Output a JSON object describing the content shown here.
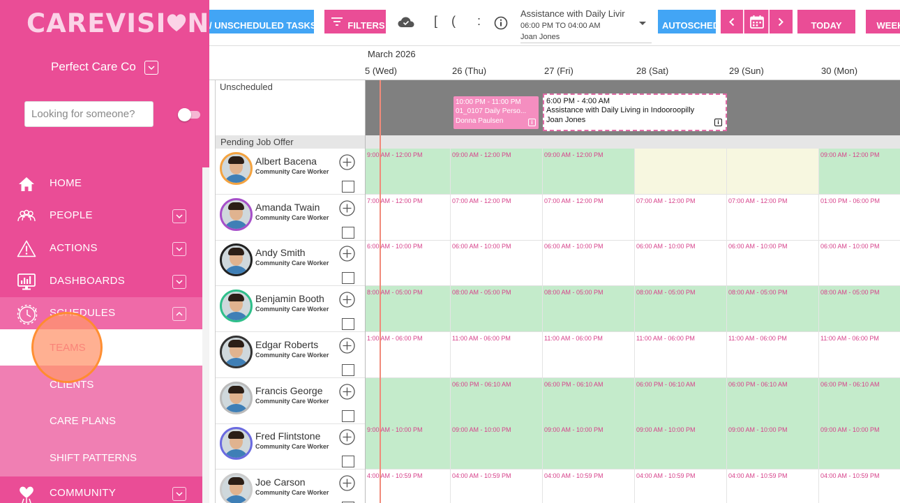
{
  "app": {
    "logo_prefix": "CAREVISI",
    "logo_suffix": "N",
    "organisation": "Perfect Care Co"
  },
  "search": {
    "placeholder": "Looking for someone?"
  },
  "nav": {
    "home": "HOME",
    "people": "PEOPLE",
    "actions": "ACTIONS",
    "dashboards": "DASHBOARDS",
    "schedules": "SCHEDULES",
    "teams": "TEAMS",
    "clients": "CLIENTS",
    "care_plans": "CARE PLANS",
    "shift_patterns": "SHIFT PATTERNS",
    "community": "COMMUNITY"
  },
  "toolbar": {
    "unscheduled_tasks": "/ UNSCHEDULED TASKS",
    "filters": "FILTERS",
    "glyph_a": "[",
    "glyph_b": "(",
    "glyph_c": ":",
    "autoschedule": "AUTOSCHED",
    "today": "TODAY",
    "week": "WEEK"
  },
  "selected_task": {
    "title": "Assistance with Daily Livir",
    "time": "06:00 PM TO 04:00 AM",
    "person": "Joan Jones"
  },
  "calendar": {
    "month": "March 2026",
    "days": [
      "5 (Wed)",
      "26 (Thu)",
      "27 (Fri)",
      "28 (Sat)",
      "29 (Sun)",
      "30 (Mon)"
    ],
    "unscheduled_label": "Unscheduled",
    "pending_label": "Pending Job Offer",
    "unscheduled_tasks": [
      {
        "time": "10:00 PM - 11:00 PM",
        "title": "01_0107 Daily Perso...",
        "person": "Donna Paulsen"
      },
      {
        "time": "6:00 PM - 4:00 AM",
        "title": "Assistance with Daily Living in Indooroopilly",
        "person": "Joan Jones"
      }
    ],
    "info_glyph": "i"
  },
  "colors": {
    "brand_pink": "#ea4d96",
    "action_blue": "#42a5f5",
    "available_green": "#c4ebcb",
    "shift_text": "#d6418a"
  },
  "staff": [
    {
      "name": "Albert Bacena",
      "role": "Community Care Worker",
      "ring": "#f4a340",
      "shifts": [
        "9:00 AM - 12:00 PM",
        "09:00 AM - 12:00 PM",
        "09:00 AM - 12:00 PM",
        "",
        "",
        "09:00 AM - 12:00 PM"
      ],
      "avail": [
        1,
        1,
        1,
        2,
        2,
        1
      ]
    },
    {
      "name": "Amanda Twain",
      "role": "Community Care Worker",
      "ring": "#a64fc9",
      "shifts": [
        "7:00 AM - 12:00 PM",
        "07:00 AM - 12:00 PM",
        "07:00 AM - 12:00 PM",
        "07:00 AM - 12:00 PM",
        "07:00 AM - 12:00 PM",
        "01:00 PM - 06:00 PM"
      ],
      "avail": [
        0,
        0,
        0,
        0,
        0,
        0
      ]
    },
    {
      "name": "Andy Smith",
      "role": "Community Care Worker",
      "ring": "#222222",
      "shifts": [
        "6:00 AM - 10:00 PM",
        "06:00 AM - 10:00 PM",
        "06:00 AM - 10:00 PM",
        "06:00 AM - 10:00 PM",
        "06:00 AM - 10:00 PM",
        "06:00 AM - 10:00 PM"
      ],
      "avail": [
        0,
        0,
        0,
        0,
        0,
        0
      ]
    },
    {
      "name": "Benjamin Booth",
      "role": "Community Care Worker",
      "ring": "#2fbf8a",
      "shifts": [
        "8:00 AM - 05:00 PM",
        "08:00 AM - 05:00 PM",
        "08:00 AM - 05:00 PM",
        "08:00 AM - 05:00 PM",
        "08:00 AM - 05:00 PM",
        "08:00 AM - 05:00 PM"
      ],
      "avail": [
        1,
        1,
        1,
        1,
        1,
        1
      ]
    },
    {
      "name": "Edgar Roberts",
      "role": "Community Care Worker",
      "ring": "#333333",
      "shifts": [
        "1:00 AM - 06:00 PM",
        "11:00 AM - 06:00 PM",
        "11:00 AM - 06:00 PM",
        "11:00 AM - 06:00 PM",
        "11:00 AM - 06:00 PM",
        "11:00 AM - 06:00 PM"
      ],
      "avail": [
        0,
        0,
        0,
        0,
        0,
        0
      ]
    },
    {
      "name": "Francis George",
      "role": "Community Care Worker",
      "ring": "#bbbbbb",
      "shifts": [
        "",
        "06:00 PM - 06:10 AM",
        "06:00 PM - 06:10 AM",
        "06:00 PM - 06:10 AM",
        "06:00 PM - 06:10 AM",
        "06:00 PM - 06:10 AM"
      ],
      "avail": [
        1,
        1,
        1,
        1,
        1,
        1
      ]
    },
    {
      "name": "Fred Flintstone",
      "role": "Community Care Worker",
      "ring": "#6a6ae0",
      "shifts": [
        "9:00 AM - 10:00 PM",
        "09:00 AM - 10:00 PM",
        "09:00 AM - 10:00 PM",
        "09:00 AM - 10:00 PM",
        "09:00 AM - 10:00 PM",
        "09:00 AM - 10:00 PM"
      ],
      "avail": [
        1,
        1,
        1,
        1,
        1,
        1
      ]
    },
    {
      "name": "Joe Carson",
      "role": "Community Care Worker",
      "ring": "#cccccc",
      "shifts": [
        "4:00 AM - 10:59 PM",
        "04:00 AM - 10:59 PM",
        "04:00 AM - 10:59 PM",
        "04:00 AM - 10:59 PM",
        "04:00 AM - 10:59 PM",
        "04:00 AM - 10:59 PM"
      ],
      "avail": [
        0,
        0,
        0,
        0,
        0,
        0
      ]
    }
  ]
}
